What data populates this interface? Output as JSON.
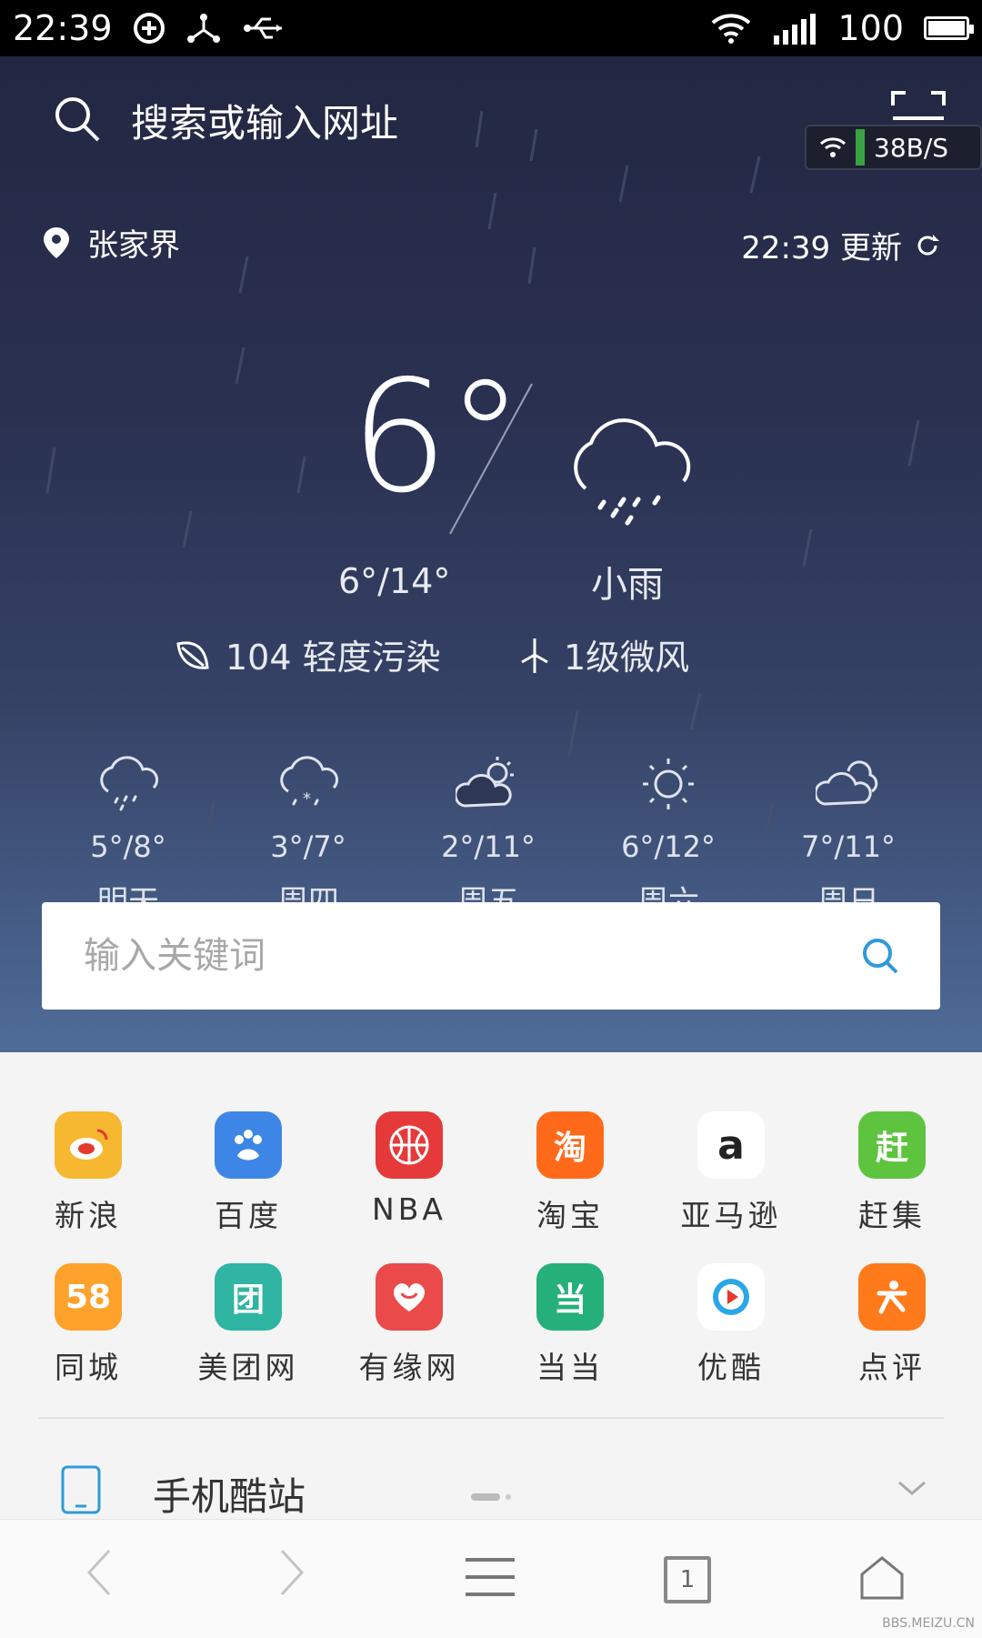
{
  "status_bar": {
    "time": "22:39",
    "battery": "100"
  },
  "top_search": {
    "label": "搜索或输入网址",
    "speed": "38B/S"
  },
  "weather": {
    "location": "张家界",
    "updated": "22:39 更新",
    "current_temp": "6°",
    "range": "6°/14°",
    "condition": "小雨",
    "aqi": "104 轻度污染",
    "wind": "1级微风"
  },
  "forecast": [
    {
      "range": "5°/8°",
      "day": "明天",
      "icon": "rain-icon"
    },
    {
      "range": "3°/7°",
      "day": "周四",
      "icon": "sleet-icon"
    },
    {
      "range": "2°/11°",
      "day": "周五",
      "icon": "partly-cloudy-icon"
    },
    {
      "range": "6°/12°",
      "day": "周六",
      "icon": "sunny-icon"
    },
    {
      "range": "7°/11°",
      "day": "周日",
      "icon": "cloudy-icon"
    }
  ],
  "keyword_search": {
    "placeholder": "输入关键词"
  },
  "shortcuts": [
    {
      "label": "新浪",
      "icon": "sina-icon",
      "color": "#f6b830"
    },
    {
      "label": "百度",
      "icon": "baidu-icon",
      "color": "#3e86e6"
    },
    {
      "label": "NBA",
      "icon": "nba-icon",
      "color": "#e63a3a"
    },
    {
      "label": "淘宝",
      "icon": "taobao-icon",
      "color": "#ff6a1a"
    },
    {
      "label": "亚马逊",
      "icon": "amazon-icon",
      "color": "#ffffff"
    },
    {
      "label": "赶集",
      "icon": "ganji-icon",
      "color": "#5ec43f"
    },
    {
      "label": "同城",
      "icon": "58-icon",
      "color": "#ffa22b"
    },
    {
      "label": "美团网",
      "icon": "meituan-icon",
      "color": "#2fb5a2"
    },
    {
      "label": "有缘网",
      "icon": "youyuan-icon",
      "color": "#ea4a4a"
    },
    {
      "label": "当当",
      "icon": "dangdang-icon",
      "color": "#25b07a"
    },
    {
      "label": "优酷",
      "icon": "youku-icon",
      "color": "#ffffff"
    },
    {
      "label": "点评",
      "icon": "dianping-icon",
      "color": "#ff7a1a"
    }
  ],
  "tile_glyphs": {
    "taobao": "淘",
    "amazon": "a",
    "ganji": "赶",
    "tongcheng": "58",
    "meituan": "团",
    "dangdang": "当"
  },
  "cool_sites": {
    "title": "手机酷站"
  },
  "bottom_nav": {
    "tab_count": "1"
  },
  "watermark": "BBS.MEIZU.CN"
}
